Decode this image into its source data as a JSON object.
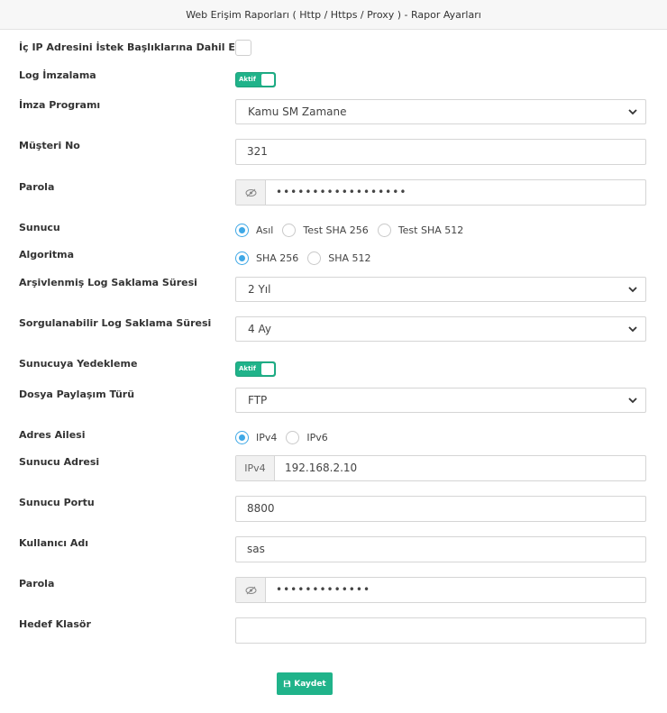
{
  "header": {
    "title": "Web Erişim Raporları ( Http / Https / Proxy ) - Rapor Ayarları"
  },
  "form": {
    "ic_ip": {
      "label": "İç IP Adresini İstek Başlıklarına Dahil Et",
      "checked": false
    },
    "log_imzalama": {
      "label": "Log İmzalama",
      "toggle_text": "Aktif",
      "on": true
    },
    "imza_programi": {
      "label": "İmza Programı",
      "value": "Kamu SM Zamane"
    },
    "musteri_no": {
      "label": "Müşteri No",
      "value": "321"
    },
    "parola1": {
      "label": "Parola",
      "value": "••••••••••••••••••"
    },
    "sunucu": {
      "label": "Sunucu",
      "options": [
        "Asıl",
        "Test SHA 256",
        "Test SHA 512"
      ],
      "selected": "Asıl"
    },
    "algoritma": {
      "label": "Algoritma",
      "options": [
        "SHA 256",
        "SHA 512"
      ],
      "selected": "SHA 256"
    },
    "arsiv_sure": {
      "label": "Arşivlenmiş Log Saklama Süresi",
      "value": "2 Yıl"
    },
    "sorgu_sure": {
      "label": "Sorgulanabilir Log Saklama Süresi",
      "value": "4 Ay"
    },
    "yedekleme": {
      "label": "Sunucuya Yedekleme",
      "toggle_text": "Aktif",
      "on": true
    },
    "dosya_paylasim": {
      "label": "Dosya Paylaşım Türü",
      "value": "FTP"
    },
    "adres_ailesi": {
      "label": "Adres Ailesi",
      "options": [
        "IPv4",
        "IPv6"
      ],
      "selected": "IPv4"
    },
    "sunucu_adresi": {
      "label": "Sunucu Adresi",
      "addon": "IPv4",
      "value": "192.168.2.10"
    },
    "sunucu_portu": {
      "label": "Sunucu Portu",
      "value": "8800"
    },
    "kullanici_adi": {
      "label": "Kullanıcı Adı",
      "value": "sas"
    },
    "parola2": {
      "label": "Parola",
      "value": "•••••••••••••"
    },
    "hedef_klasor": {
      "label": "Hedef Klasör",
      "value": ""
    }
  },
  "actions": {
    "save_label": "Kaydet",
    "save_icon": "floppy-disk-icon"
  },
  "colors": {
    "accent_green": "#20b38a",
    "radio_blue": "#3fa8e6"
  }
}
